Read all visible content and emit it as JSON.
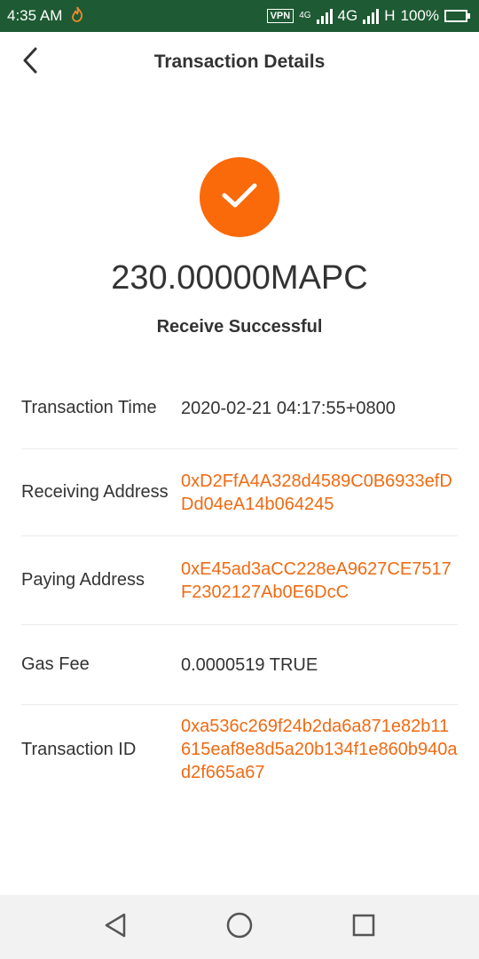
{
  "status_bar": {
    "time": "4:35 AM",
    "vpn": "VPN",
    "net1": "4G",
    "net2": "4G",
    "net3": "H",
    "battery": "100%"
  },
  "header": {
    "title": "Transaction Details"
  },
  "transaction": {
    "amount": "230.00000MAPC",
    "status": "Receive Successful",
    "rows": [
      {
        "label": "Transaction Time",
        "value": "2020-02-21 04:17:55+0800"
      },
      {
        "label": "Receiving Address",
        "value": "0xD2FfA4A328d4589C0B6933efDDd04eA14b064245"
      },
      {
        "label": "Paying Address",
        "value": "0xE45ad3aCC228eA9627CE7517F2302127Ab0E6DcC"
      },
      {
        "label": "Gas Fee",
        "value": "0.0000519 TRUE"
      },
      {
        "label": "Transaction ID",
        "value": "0xa536c269f24b2da6a871e82b11615eaf8e8d5a20b134f1e860b940ad2f665a67"
      }
    ]
  },
  "colors": {
    "accent": "#fa6a0a",
    "link": "#f06a12",
    "status_bar_bg": "#1e5a33"
  },
  "icons": {
    "back": "chevron-left-icon",
    "success": "checkmark-icon",
    "nav_back": "triangle-back-icon",
    "nav_home": "circle-home-icon",
    "nav_recents": "square-recents-icon"
  }
}
